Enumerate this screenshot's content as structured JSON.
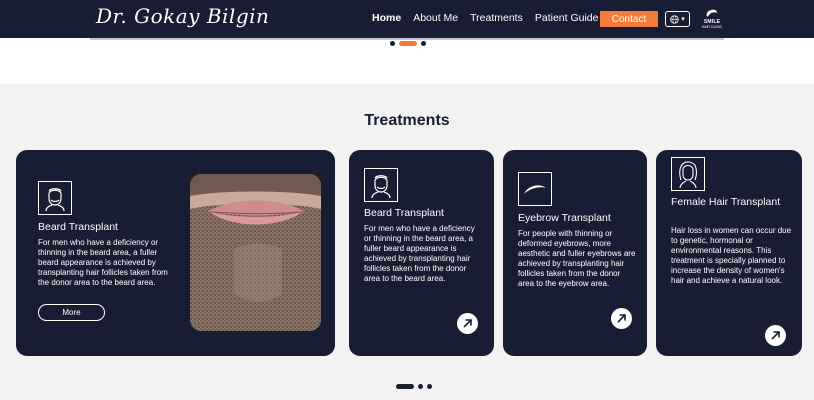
{
  "header": {
    "logo_text": "Dr. Gokay Bilgin",
    "nav": [
      {
        "label": "Home",
        "active": true
      },
      {
        "label": "About Me",
        "active": false
      },
      {
        "label": "Treatments",
        "active": false
      },
      {
        "label": "Patient Guide",
        "active": false
      }
    ],
    "contact_label": "Contact",
    "language_icon": "globe-icon",
    "partner_logo": {
      "line1": "SMILE",
      "line2": "HAIR CLINIC"
    }
  },
  "section": {
    "title": "Treatments"
  },
  "cards": [
    {
      "title": "Beard Transplant",
      "description": "For men who have a deficiency or thinning in the beard area, a fuller beard appearance is achieved by transplanting hair follicles taken from the donor area to the beard area.",
      "button": "More",
      "icon": "bearded-man-icon"
    },
    {
      "title": "Beard Transplant",
      "description": "For men who have a deficiency or thinning in the beard area, a fuller beard appearance is achieved by transplanting hair follicles taken from the donor area to the beard area.",
      "icon": "bearded-man-icon"
    },
    {
      "title": "Eyebrow Transplant",
      "description": "For people with thinning or deformed eyebrows, more aesthetic and fuller eyebrows are achieved by transplanting hair follicles taken from the donor area to the eyebrow area.",
      "icon": "eyebrow-icon"
    },
    {
      "title": "Female Hair Transplant",
      "description": "Hair loss in women can occur due to genetic, hormonal or environmental reasons. This treatment is specially planned to increase the density of women's hair and achieve a natural look.",
      "icon": "woman-icon"
    }
  ],
  "colors": {
    "navy": "#181d33",
    "accent": "#f47b3b",
    "background": "#f2f2f2"
  }
}
